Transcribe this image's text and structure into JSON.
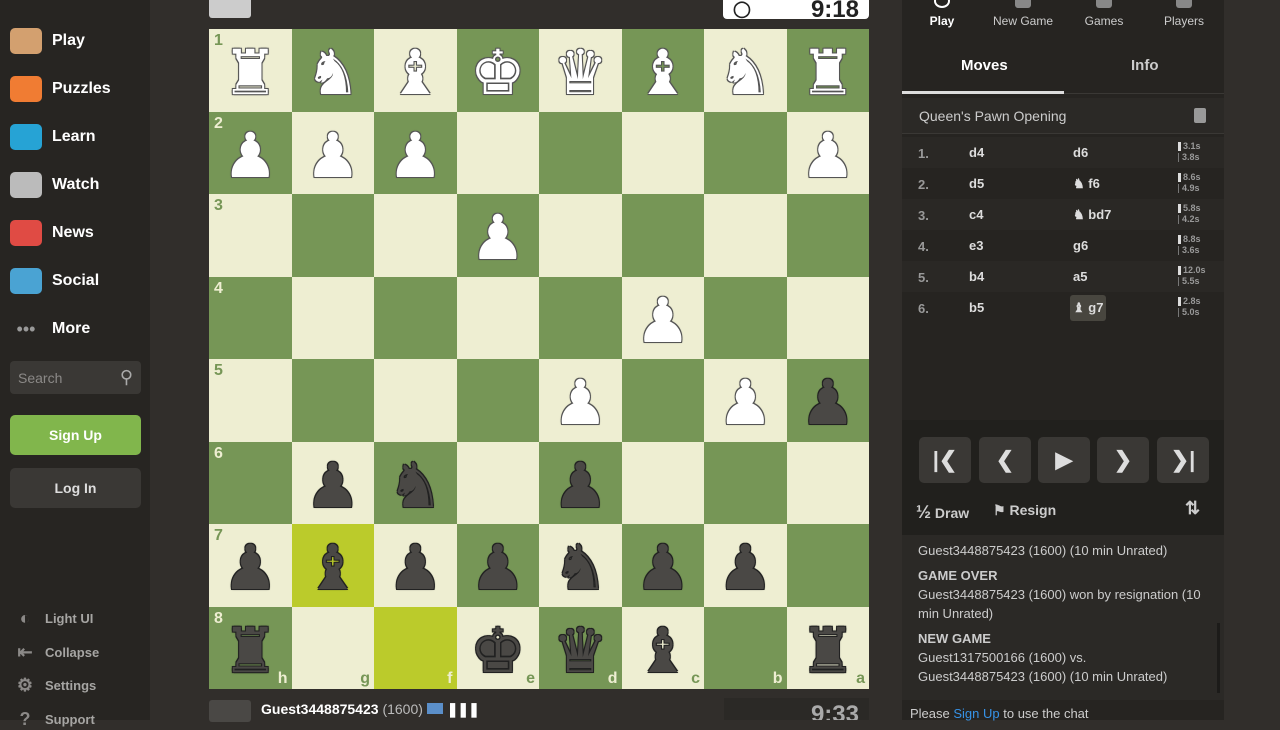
{
  "sidebar": {
    "items": [
      {
        "label": "Play",
        "icon": "play-pawn-icon",
        "color": "#d3a06f"
      },
      {
        "label": "Puzzles",
        "icon": "puzzle-icon",
        "color": "#f07c33"
      },
      {
        "label": "Learn",
        "icon": "graduation-cap-icon",
        "color": "#26a3d5"
      },
      {
        "label": "Watch",
        "icon": "binoculars-icon",
        "color": "#bbbbbb"
      },
      {
        "label": "News",
        "icon": "newspaper-icon",
        "color": "#e04b44"
      },
      {
        "label": "Social",
        "icon": "people-icon",
        "color": "#4aa3d3"
      },
      {
        "label": "More",
        "icon": "dots-icon",
        "color": "#999999"
      }
    ],
    "search_placeholder": "Search",
    "signup": "Sign Up",
    "login": "Log In",
    "footer": [
      {
        "label": "Light UI",
        "icon": "half-circle-icon"
      },
      {
        "label": "Collapse",
        "icon": "collapse-arrow-icon"
      },
      {
        "label": "Settings",
        "icon": "gear-icon"
      },
      {
        "label": "Support",
        "icon": "help-icon"
      }
    ]
  },
  "top_player": {
    "clock": "9:18"
  },
  "bottom_player": {
    "name": "Guest3448875423",
    "rating": "(1600)",
    "clock": "9:33"
  },
  "board": {
    "rows": [
      "RNBKQBNR",
      "PPP....P",
      "...P....",
      ".....P..",
      "....P.Pp",
      ".pn.p...",
      "pbppnpp.",
      "r..kqb.r"
    ],
    "rank_labels": [
      "1",
      "2",
      "3",
      "4",
      "5",
      "6",
      "7",
      "8"
    ],
    "file_labels": [
      "h",
      "g",
      "f",
      "e",
      "d",
      "c",
      "b",
      "a"
    ],
    "highlights": [
      "g7",
      "f8"
    ],
    "colors": {
      "light": "#eeeed2",
      "dark": "#769656",
      "highlight": "#bbcb2b"
    }
  },
  "panel": {
    "top_tabs": [
      "Play",
      "New Game",
      "Games",
      "Players"
    ],
    "tabs": [
      "Moves",
      "Info"
    ],
    "opening": "Queen's Pawn Opening",
    "moves": [
      {
        "n": "1.",
        "w": "d4",
        "b": "d6",
        "tw": "3.1s",
        "tb": "3.8s"
      },
      {
        "n": "2.",
        "w": "d5",
        "b": "♞ f6",
        "tw": "8.6s",
        "tb": "4.9s"
      },
      {
        "n": "3.",
        "w": "c4",
        "b": "♞ bd7",
        "tw": "5.8s",
        "tb": "4.2s"
      },
      {
        "n": "4.",
        "w": "e3",
        "b": "g6",
        "tw": "8.8s",
        "tb": "3.6s"
      },
      {
        "n": "5.",
        "w": "b4",
        "b": "a5",
        "tw": "12.0s",
        "tb": "5.5s"
      },
      {
        "n": "6.",
        "w": "b5",
        "b": "♝ g7",
        "tw": "2.8s",
        "tb": "5.0s"
      }
    ],
    "draw": "Draw",
    "draw_icon": "½",
    "resign": "Resign",
    "chat": {
      "line0": "Guest3448875423 (1600) (10 min Unrated)",
      "h1": "GAME OVER",
      "l1": "Guest3448875423 (1600) won by resignation (10 min Unrated)",
      "h2": "NEW GAME",
      "l2a": "Guest1317500166 (1600) vs.",
      "l2b": "Guest3448875423 (1600) (10 min Unrated)"
    },
    "chat_footer": {
      "pre": "Please ",
      "link": "Sign Up",
      "post": " to use the chat"
    }
  }
}
